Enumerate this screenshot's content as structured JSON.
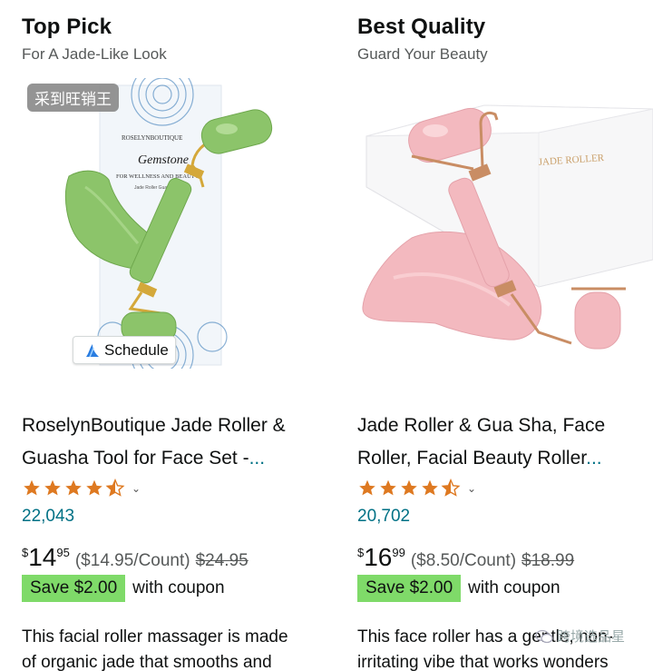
{
  "products": [
    {
      "badge_title": "Top Pick",
      "badge_subtitle": "For A Jade-Like Look",
      "watermark_tag": "采到旺销王",
      "schedule_label": "Schedule",
      "title_line1": "RoselynBoutique Jade Roller &",
      "title_line2": "Guasha Tool for Face Set -",
      "title_ellipsis": "...",
      "rating": 4.5,
      "reviews": "22,043",
      "price_symbol": "$",
      "price_whole": "14",
      "price_fraction": "95",
      "unit_price": "($14.95/Count)",
      "list_price": "$24.95",
      "coupon": "Save $2.00",
      "coupon_suffix": "with coupon",
      "desc_line1": "This facial roller massager is made",
      "desc_line2": "of organic jade that smooths and",
      "package_brand": "ROSELYNBOUTIQUE",
      "package_title": "Gemstone",
      "package_subtitle": "FOR WELLNESS AND BEAUTY",
      "package_small": "Jade Roller Gua Sha Set"
    },
    {
      "badge_title": "Best Quality",
      "badge_subtitle": "Guard Your Beauty",
      "title_line1": "Jade Roller & Gua Sha, Face",
      "title_line2": "Roller, Facial Beauty Roller",
      "title_ellipsis": "...",
      "rating": 4.5,
      "reviews": "20,702",
      "price_symbol": "$",
      "price_whole": "16",
      "price_fraction": "99",
      "unit_price": "($8.50/Count)",
      "list_price": "$18.99",
      "coupon": "Save $2.00",
      "coupon_suffix": "with coupon",
      "desc_line1": "This face roller has a gentle, non-",
      "desc_line2": "irritating vibe that works wonders",
      "box_text": "JADE ROLLER"
    }
  ],
  "overlay_watermark": "跨境选品星",
  "colors": {
    "link": "#007185",
    "coupon_bg": "#7fda69",
    "star": "#de7921",
    "jade": "#8cc46a",
    "rose": "#f3b9bf"
  },
  "icons": [
    "star-icon",
    "chevron-down-icon",
    "schedule-icon",
    "wechat-icon"
  ]
}
